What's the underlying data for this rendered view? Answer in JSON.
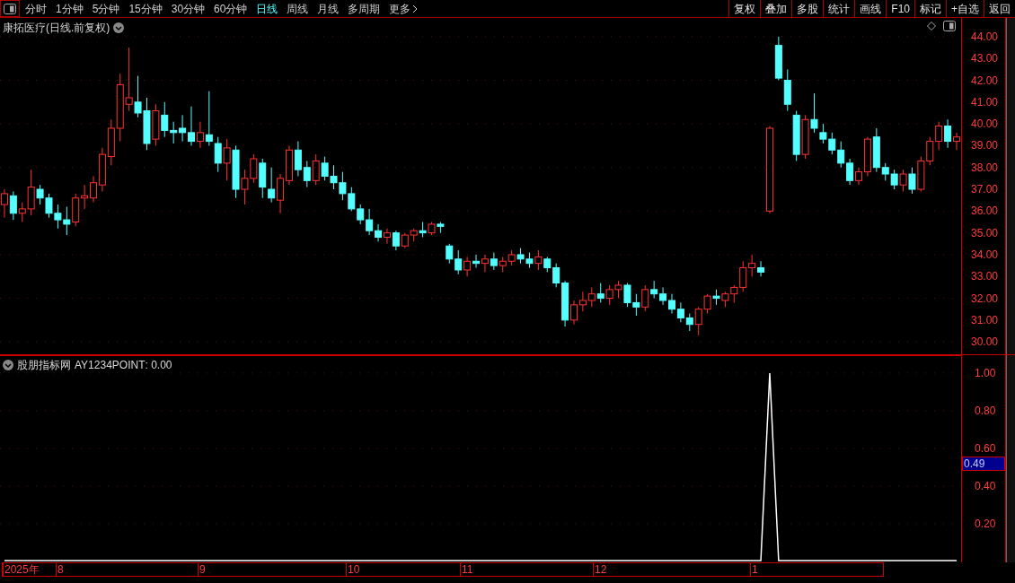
{
  "toolbar": {
    "tabs": [
      {
        "label": "分时",
        "selected": false
      },
      {
        "label": "1分钟",
        "selected": false
      },
      {
        "label": "5分钟",
        "selected": false
      },
      {
        "label": "15分钟",
        "selected": false
      },
      {
        "label": "30分钟",
        "selected": false
      },
      {
        "label": "60分钟",
        "selected": false
      },
      {
        "label": "日线",
        "selected": true
      },
      {
        "label": "周线",
        "selected": false
      },
      {
        "label": "月线",
        "selected": false
      },
      {
        "label": "多周期",
        "selected": false
      }
    ],
    "more": "更多",
    "buttons": [
      "复权",
      "叠加",
      "多股",
      "统计",
      "画线",
      "F10",
      "标记",
      "+自选",
      "返回"
    ]
  },
  "price_panel": {
    "title": "康拓医疗(日线.前复权)",
    "chart_data": {
      "type": "candlestick",
      "ylim": [
        29.39,
        44.86
      ],
      "yticks": [
        {
          "value": 44,
          "label": "44.00"
        },
        {
          "value": 43,
          "label": "43.00"
        },
        {
          "value": 42,
          "label": "42.00"
        },
        {
          "value": 41,
          "label": "41.00"
        },
        {
          "value": 40,
          "label": "40.00"
        },
        {
          "value": 39,
          "label": "39.00"
        },
        {
          "value": 38,
          "label": "38.00"
        },
        {
          "value": 37,
          "label": "37.00"
        },
        {
          "value": 36,
          "label": "36.00"
        },
        {
          "value": 35,
          "label": "35.00"
        },
        {
          "value": 34,
          "label": "34.00"
        },
        {
          "value": 33,
          "label": "33.00"
        },
        {
          "value": 32,
          "label": "32.00"
        },
        {
          "value": 31,
          "label": "31.00"
        },
        {
          "value": 30,
          "label": "30.00"
        }
      ],
      "grid": true,
      "ohlc": [
        [
          36.3,
          37.0,
          35.7,
          36.8
        ],
        [
          36.7,
          36.9,
          35.6,
          35.9
        ],
        [
          35.9,
          36.4,
          35.5,
          36.1
        ],
        [
          36.1,
          37.9,
          35.8,
          37.1
        ],
        [
          37.0,
          37.2,
          36.3,
          36.6
        ],
        [
          36.6,
          36.8,
          35.7,
          35.9
        ],
        [
          35.9,
          36.3,
          35.2,
          35.6
        ],
        [
          35.6,
          36.2,
          34.9,
          35.4
        ],
        [
          35.5,
          36.8,
          35.3,
          36.6
        ],
        [
          36.6,
          37.2,
          36.1,
          36.7
        ],
        [
          36.6,
          37.6,
          36.4,
          37.3
        ],
        [
          37.2,
          38.9,
          36.9,
          38.6
        ],
        [
          38.5,
          40.2,
          38.1,
          39.8
        ],
        [
          39.8,
          42.3,
          39.2,
          41.8
        ],
        [
          40.9,
          43.5,
          40.6,
          41.2
        ],
        [
          41.0,
          42.2,
          40.3,
          40.5
        ],
        [
          40.6,
          41.2,
          38.8,
          39.1
        ],
        [
          39.3,
          40.9,
          39.0,
          40.6
        ],
        [
          40.4,
          41.0,
          39.4,
          39.7
        ],
        [
          39.7,
          40.1,
          39.1,
          39.6
        ],
        [
          39.8,
          40.4,
          39.2,
          39.6
        ],
        [
          39.6,
          40.8,
          39.0,
          39.2
        ],
        [
          39.2,
          40.1,
          38.9,
          39.6
        ],
        [
          39.5,
          41.5,
          39.0,
          39.2
        ],
        [
          39.1,
          39.4,
          37.8,
          38.2
        ],
        [
          38.2,
          39.3,
          37.4,
          38.9
        ],
        [
          38.8,
          39.0,
          36.6,
          37.0
        ],
        [
          37.0,
          37.9,
          36.3,
          37.5
        ],
        [
          37.5,
          38.6,
          37.3,
          38.4
        ],
        [
          38.2,
          38.4,
          36.6,
          37.1
        ],
        [
          37.0,
          38.0,
          36.4,
          36.6
        ],
        [
          36.5,
          37.7,
          35.9,
          37.5
        ],
        [
          37.4,
          39.0,
          37.2,
          38.8
        ],
        [
          38.8,
          39.2,
          37.6,
          37.9
        ],
        [
          38.0,
          38.3,
          37.1,
          37.4
        ],
        [
          37.4,
          38.6,
          37.2,
          38.3
        ],
        [
          38.2,
          38.5,
          37.4,
          37.6
        ],
        [
          37.6,
          38.1,
          37.0,
          37.3
        ],
        [
          37.3,
          37.8,
          36.5,
          36.8
        ],
        [
          36.8,
          37.1,
          36.0,
          36.1
        ],
        [
          36.1,
          36.3,
          35.4,
          35.6
        ],
        [
          35.6,
          36.1,
          34.9,
          35.1
        ],
        [
          35.1,
          35.4,
          34.6,
          34.8
        ],
        [
          34.8,
          35.2,
          34.5,
          35.0
        ],
        [
          35.0,
          35.1,
          34.2,
          34.4
        ],
        [
          34.4,
          35.0,
          34.3,
          34.9
        ],
        [
          34.9,
          35.2,
          34.6,
          35.1
        ],
        [
          35.1,
          35.5,
          34.8,
          35.0
        ],
        [
          35.0,
          35.5,
          34.9,
          35.4
        ],
        [
          35.4,
          35.5,
          35.0,
          35.3
        ],
        [
          34.4,
          34.5,
          33.6,
          33.8
        ],
        [
          33.8,
          34.2,
          33.1,
          33.3
        ],
        [
          33.3,
          33.9,
          33.0,
          33.7
        ],
        [
          33.7,
          34.0,
          33.4,
          33.6
        ],
        [
          33.6,
          34.0,
          33.2,
          33.8
        ],
        [
          33.8,
          34.1,
          33.3,
          33.5
        ],
        [
          33.5,
          33.9,
          33.2,
          33.7
        ],
        [
          33.7,
          34.2,
          33.5,
          34.0
        ],
        [
          34.0,
          34.3,
          33.6,
          33.8
        ],
        [
          33.8,
          34.1,
          33.4,
          33.6
        ],
        [
          33.6,
          34.2,
          33.3,
          33.9
        ],
        [
          33.8,
          33.9,
          33.2,
          33.4
        ],
        [
          33.4,
          33.6,
          32.5,
          32.7
        ],
        [
          32.7,
          32.8,
          30.7,
          31.0
        ],
        [
          31.0,
          31.9,
          30.8,
          31.7
        ],
        [
          31.7,
          32.3,
          31.4,
          31.9
        ],
        [
          31.9,
          32.5,
          31.6,
          32.2
        ],
        [
          32.2,
          32.7,
          31.8,
          32.0
        ],
        [
          32.0,
          32.6,
          31.7,
          32.4
        ],
        [
          32.4,
          32.8,
          32.0,
          32.6
        ],
        [
          32.6,
          32.7,
          31.6,
          31.8
        ],
        [
          31.8,
          32.2,
          31.2,
          31.6
        ],
        [
          31.6,
          32.6,
          31.4,
          32.4
        ],
        [
          32.4,
          32.8,
          32.0,
          32.2
        ],
        [
          32.2,
          32.5,
          31.7,
          31.9
        ],
        [
          31.9,
          32.2,
          31.3,
          31.5
        ],
        [
          31.5,
          31.8,
          30.9,
          31.1
        ],
        [
          31.1,
          31.3,
          30.5,
          30.8
        ],
        [
          30.8,
          31.6,
          30.3,
          31.5
        ],
        [
          31.5,
          32.2,
          31.3,
          32.1
        ],
        [
          32.1,
          32.4,
          31.7,
          32.0
        ],
        [
          31.9,
          32.3,
          31.6,
          32.2
        ],
        [
          32.2,
          32.6,
          31.8,
          32.5
        ],
        [
          32.5,
          33.7,
          32.3,
          33.4
        ],
        [
          33.4,
          34.0,
          33.0,
          33.6
        ],
        [
          33.4,
          33.7,
          33.0,
          33.2
        ],
        [
          36.0,
          39.9,
          35.9,
          39.8
        ],
        [
          43.6,
          44.0,
          42.0,
          42.1
        ],
        [
          42.0,
          42.5,
          40.6,
          40.9
        ],
        [
          40.4,
          40.6,
          38.3,
          38.6
        ],
        [
          38.6,
          40.4,
          38.4,
          40.2
        ],
        [
          40.2,
          41.4,
          39.6,
          39.8
        ],
        [
          39.6,
          40.0,
          39.1,
          39.3
        ],
        [
          39.3,
          39.6,
          38.6,
          38.8
        ],
        [
          38.8,
          39.2,
          38.0,
          38.2
        ],
        [
          38.2,
          38.4,
          37.2,
          37.4
        ],
        [
          37.4,
          38.0,
          37.2,
          37.8
        ],
        [
          37.8,
          39.4,
          37.6,
          39.3
        ],
        [
          39.4,
          39.8,
          37.8,
          38.0
        ],
        [
          38.0,
          38.2,
          37.4,
          37.7
        ],
        [
          37.7,
          37.9,
          37.0,
          37.2
        ],
        [
          37.2,
          37.9,
          36.9,
          37.7
        ],
        [
          37.7,
          38.0,
          36.8,
          37.0
        ],
        [
          37.0,
          38.5,
          36.9,
          38.3
        ],
        [
          38.3,
          39.4,
          38.1,
          39.2
        ],
        [
          39.2,
          40.1,
          38.8,
          39.9
        ],
        [
          39.9,
          40.2,
          38.9,
          39.2
        ],
        [
          39.2,
          39.6,
          38.8,
          39.4
        ]
      ]
    }
  },
  "indicator_panel": {
    "title": "股朋指标网",
    "reading": ": 0.00",
    "cursor_value": "0.49",
    "chart_data": {
      "type": "line",
      "grid": true,
      "ylim": [
        0,
        1.095
      ],
      "yticks": [
        {
          "value": 1,
          "label": "1.00"
        },
        {
          "value": 0.8,
          "label": "0.80"
        },
        {
          "value": 0.6,
          "label": "0.60"
        },
        {
          "value": 0.4,
          "label": "0.40"
        },
        {
          "value": 0.2,
          "label": "0.20"
        }
      ],
      "series": [
        {
          "name": "AY1234POINT",
          "color": "#ffffff",
          "values": [
            0,
            0,
            0,
            0,
            0,
            0,
            0,
            0,
            0,
            0,
            0,
            0,
            0,
            0,
            0,
            0,
            0,
            0,
            0,
            0,
            0,
            0,
            0,
            0,
            0,
            0,
            0,
            0,
            0,
            0,
            0,
            0,
            0,
            0,
            0,
            0,
            0,
            0,
            0,
            0,
            0,
            0,
            0,
            0,
            0,
            0,
            0,
            0,
            0,
            0,
            0,
            0,
            0,
            0,
            0,
            0,
            0,
            0,
            0,
            0,
            0,
            0,
            0,
            0,
            0,
            0,
            0,
            0,
            0,
            0,
            0,
            0,
            0,
            0,
            0,
            0,
            0,
            0,
            0,
            0,
            0,
            0,
            0,
            0,
            0,
            0,
            1,
            0,
            0,
            0,
            0,
            0,
            0,
            0,
            0,
            0,
            0,
            0,
            0,
            0,
            0,
            0,
            0,
            0,
            0,
            0,
            0,
            0
          ]
        }
      ]
    }
  },
  "time_axis": [
    "2025年",
    "8",
    "9",
    "10",
    "11",
    "12",
    "1"
  ]
}
